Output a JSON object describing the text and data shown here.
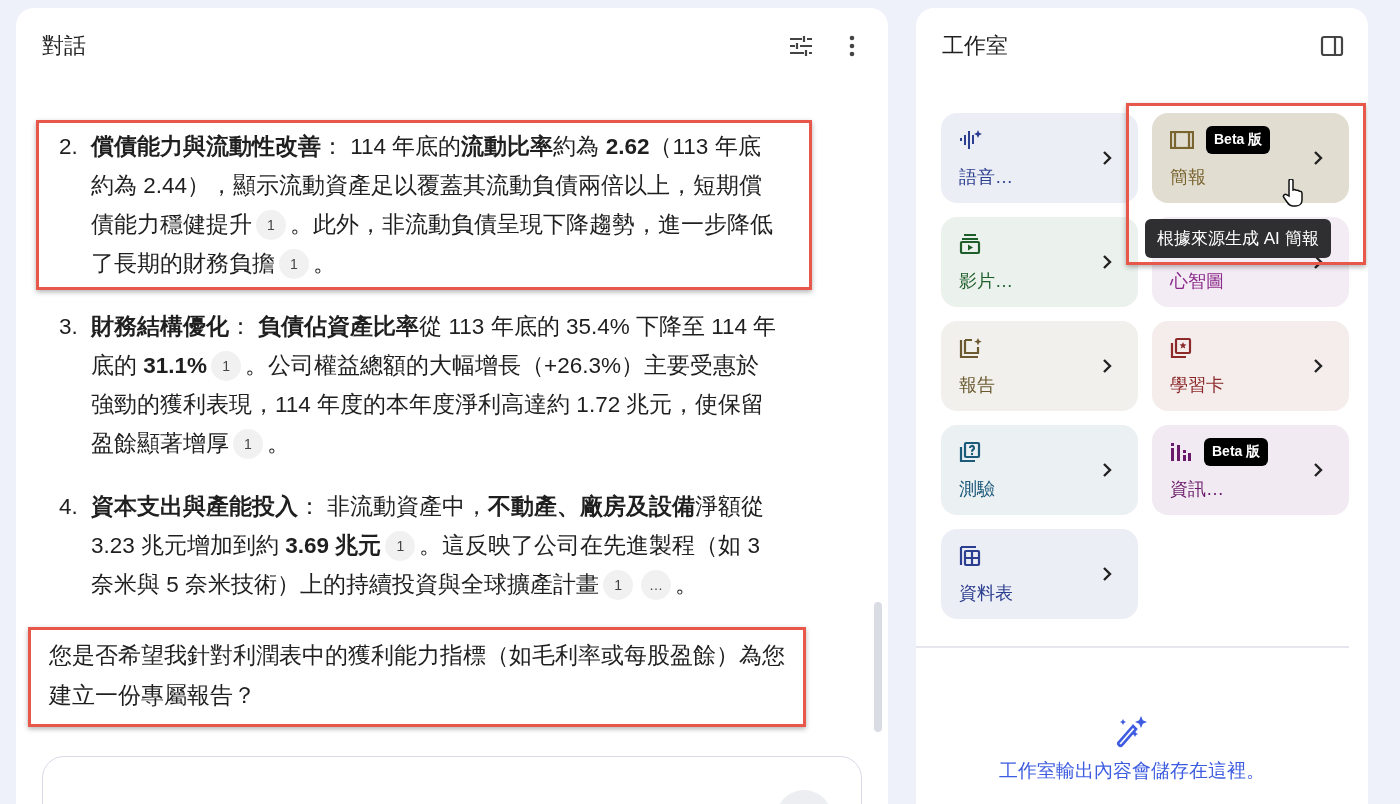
{
  "chat": {
    "title": "對話",
    "items": [
      {
        "number": "2.",
        "highlighted": true,
        "segments": [
          {
            "kind": "text",
            "text": "**償債能力與流動性改善**： 114 年底的**流動比率**約為 **2.62**（113 年底約為 2.44），顯示流動資產足以覆蓋其流動負債兩倍以上，短期償債能力穩健提升"
          },
          {
            "kind": "cite",
            "text": "1"
          },
          {
            "kind": "text",
            "text": "。此外，非流動負債呈現下降趨勢，進一步降低了長期的財務負擔"
          },
          {
            "kind": "cite",
            "text": "1"
          },
          {
            "kind": "text",
            "text": "。"
          }
        ]
      },
      {
        "number": "3.",
        "highlighted": false,
        "segments": [
          {
            "kind": "text",
            "text": "**財務結構優化**： **負債佔資產比率**從 113 年底的 35.4% 下降至 114 年底的 **31.1%**"
          },
          {
            "kind": "cite",
            "text": "1"
          },
          {
            "kind": "text",
            "text": "。公司權益總額的大幅增長（+26.3%）主要受惠於強勁的獲利表現，114 年度的本年度淨利高達約 1.72 兆元，使保留盈餘顯著增厚"
          },
          {
            "kind": "cite",
            "text": "1"
          },
          {
            "kind": "text",
            "text": "。"
          }
        ]
      },
      {
        "number": "4.",
        "highlighted": false,
        "segments": [
          {
            "kind": "text",
            "text": "**資本支出與產能投入**： 非流動資產中，**不動產、廠房及設備**淨額從 3.23 兆元增加到約 **3.69 兆元**"
          },
          {
            "kind": "cite",
            "text": "1"
          },
          {
            "kind": "text",
            "text": "。這反映了公司在先進製程（如 3 奈米與 5 奈米技術）上的持續投資與全球擴產計畫"
          },
          {
            "kind": "cite",
            "text": "1"
          },
          {
            "kind": "cite",
            "text": "…"
          },
          {
            "kind": "text",
            "text": "。"
          }
        ]
      }
    ],
    "closing": {
      "text": "您是否希望我針對利潤表中的獲利能力指標（如毛利率或每股盈餘）為您建立一份專屬報告？",
      "highlighted": true
    }
  },
  "studio": {
    "title": "工作室",
    "cards": [
      {
        "label": "語音…",
        "color": "#2c3e8f",
        "hovered": false
      },
      {
        "label": "簡報",
        "color": "#7a6530",
        "badge": "Beta 版",
        "hovered": true,
        "tooltip": "根據來源生成 AI 簡報",
        "highlighted": true
      },
      {
        "label": "影片…",
        "color": "#1e5e2a",
        "hovered": false
      },
      {
        "label": "心智圖",
        "color": "#8a2a8a",
        "hovered": false
      },
      {
        "label": "報告",
        "color": "#6b5a30",
        "hovered": false
      },
      {
        "label": "學習卡",
        "color": "#8c2a2a",
        "hovered": false
      },
      {
        "label": "測驗",
        "color": "#1c5a7a",
        "hovered": false
      },
      {
        "label": "資訊…",
        "color": "#6a1a6a",
        "badge": "Beta 版",
        "hovered": false
      },
      {
        "label": "資料表",
        "color": "#2c3e8f",
        "hovered": false
      }
    ],
    "empty_message": "工作室輸出內容會儲存在這裡。"
  }
}
